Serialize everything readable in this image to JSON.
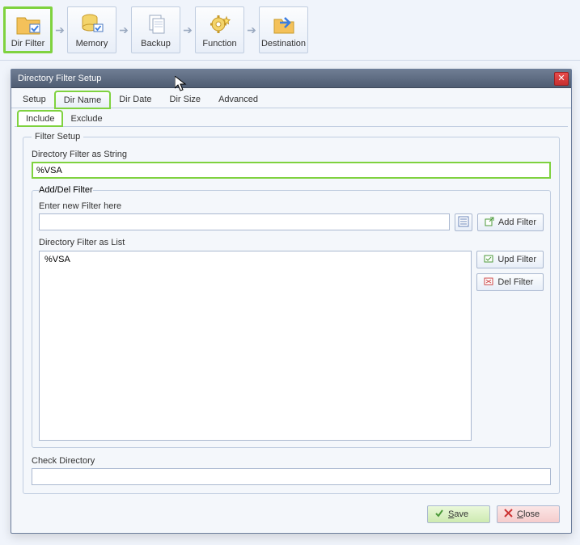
{
  "toolbar": {
    "items": [
      {
        "label": "Dir Filter",
        "icon": "folder-check"
      },
      {
        "label": "Memory",
        "icon": "database-check"
      },
      {
        "label": "Backup",
        "icon": "documents"
      },
      {
        "label": "Function",
        "icon": "gear-star"
      },
      {
        "label": "Destination",
        "icon": "folder-arrow"
      }
    ]
  },
  "dialog": {
    "title": "Directory Filter Setup",
    "tabs": [
      "Setup",
      "Dir Name",
      "Dir Date",
      "Dir Size",
      "Advanced"
    ],
    "active_tab": "Dir Name",
    "subtabs": [
      "Include",
      "Exclude"
    ],
    "active_subtab": "Include",
    "filter_setup_legend": "Filter Setup",
    "filter_string_label": "Directory Filter as String",
    "filter_string_value": "%VSA",
    "adddel_legend": "Add/Del Filter",
    "enter_label": "Enter new Filter here",
    "enter_value": "",
    "add_btn": "Add Filter",
    "list_label": "Directory Filter as List",
    "list_items": [
      "%VSA"
    ],
    "upd_btn": "Upd Filter",
    "del_btn": "Del Filter",
    "check_label": "Check Directory",
    "check_value": "",
    "save_btn": "Save",
    "close_btn": "Close"
  }
}
